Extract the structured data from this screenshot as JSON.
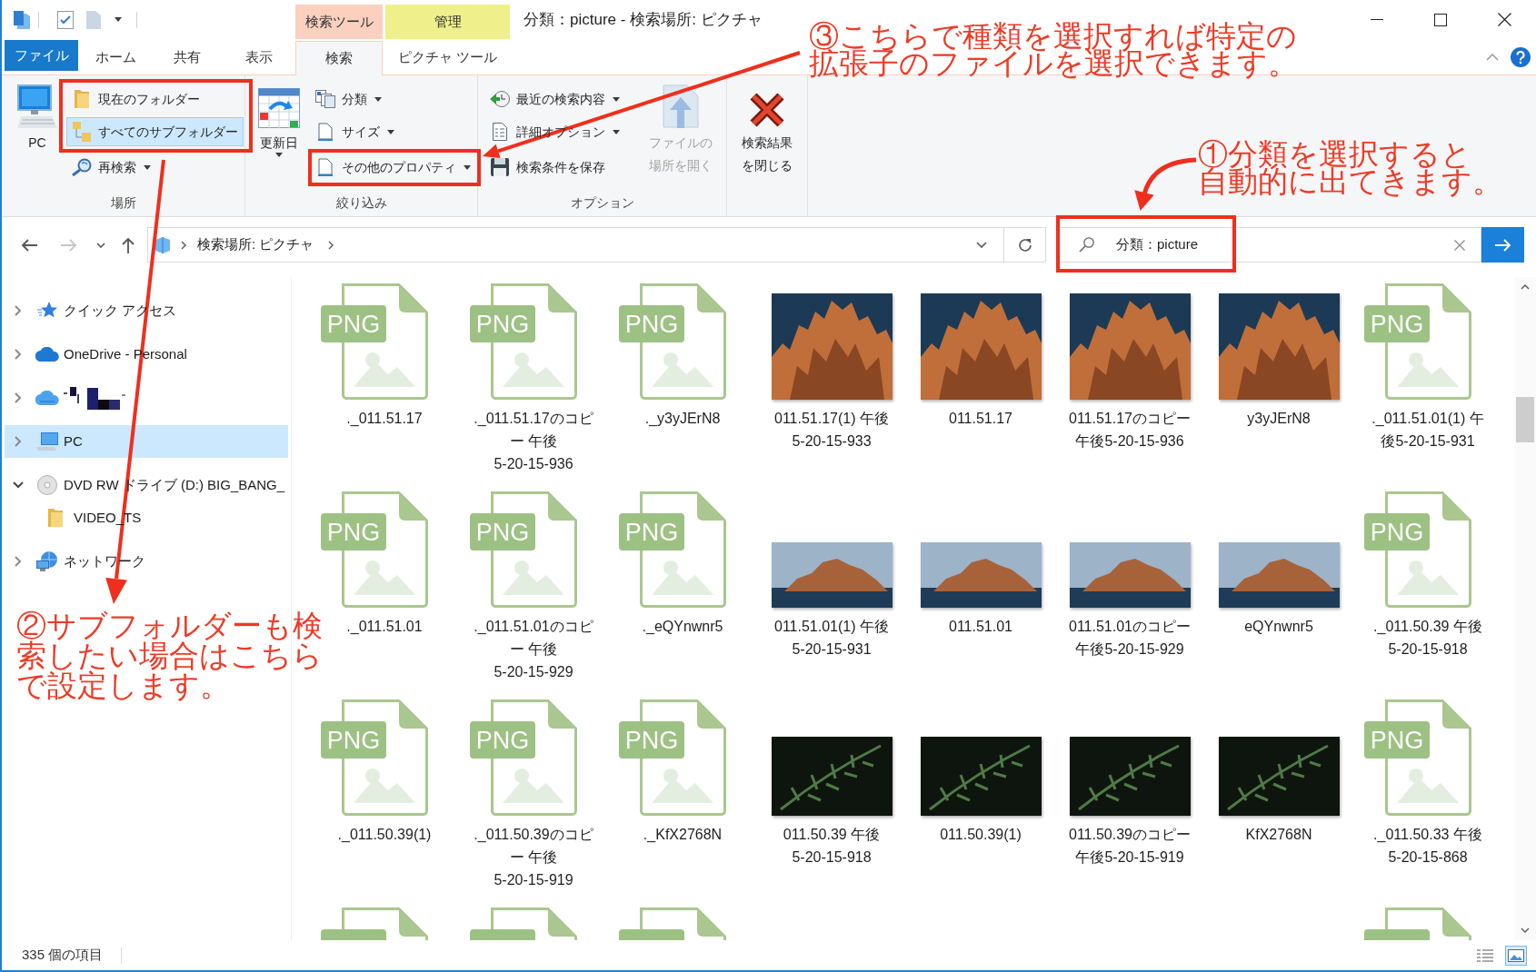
{
  "title_bar": {
    "title": "分類：picture - 検索場所: ピクチャ"
  },
  "tabs": [
    {
      "kind": "file",
      "label": "ファイル",
      "selected": false
    },
    {
      "kind": "normal",
      "label": "ホーム",
      "selected": false
    },
    {
      "kind": "normal",
      "label": "共有",
      "selected": false
    },
    {
      "kind": "normal",
      "label": "表示",
      "selected": false
    }
  ],
  "contextual_tabs": [
    {
      "header": "検索ツール",
      "color": "#fbd0bf",
      "tab": {
        "label": "検索",
        "selected": true
      }
    },
    {
      "header": "管理",
      "color": "#eff08c",
      "tab": {
        "label": "ピクチャ ツール",
        "selected": false
      }
    }
  ],
  "ribbon": {
    "groups": [
      {
        "label": "場所",
        "items": [
          {
            "kind": "large",
            "label": "PC",
            "dropdown": false,
            "disabled": false,
            "selected": false
          },
          {
            "kind": "small",
            "label": "現在のフォルダー",
            "dropdown": false,
            "disabled": false,
            "selected": false
          },
          {
            "kind": "small",
            "label": "すべてのサブフォルダー",
            "dropdown": false,
            "disabled": false,
            "selected": true
          },
          {
            "kind": "small",
            "label": "再検索",
            "dropdown": true,
            "disabled": false,
            "selected": false
          }
        ]
      },
      {
        "label": "絞り込み",
        "items": [
          {
            "kind": "large",
            "label": "更新日",
            "dropdown": true,
            "disabled": false
          },
          {
            "kind": "small",
            "label": "分類",
            "dropdown": true,
            "disabled": false
          },
          {
            "kind": "small",
            "label": "サイズ",
            "dropdown": true,
            "disabled": false
          },
          {
            "kind": "small",
            "label": "その他のプロパティ",
            "dropdown": true,
            "disabled": false
          }
        ]
      },
      {
        "label": "オプション",
        "items": [
          {
            "kind": "small",
            "label": "最近の検索内容",
            "dropdown": true,
            "disabled": false
          },
          {
            "kind": "small",
            "label": "詳細オプション",
            "dropdown": true,
            "disabled": false
          },
          {
            "kind": "small",
            "label": "検索条件を保存",
            "dropdown": false,
            "disabled": false
          },
          {
            "kind": "large",
            "label": "ファイルの場所を開く",
            "dropdown": false,
            "disabled": true
          }
        ]
      },
      {
        "items": [
          {
            "kind": "large",
            "label": "検索結果を閉じる",
            "dropdown": false,
            "disabled": false
          }
        ]
      }
    ]
  },
  "address_bar": {
    "nav_buttons": [
      {
        "kind": "back",
        "disabled": false
      },
      {
        "kind": "forward",
        "disabled": true
      },
      {
        "kind": "recent",
        "disabled": false
      },
      {
        "kind": "up",
        "disabled": false
      }
    ],
    "breadcrumbs": [
      "検索場所: ピクチャ"
    ]
  },
  "search_box": {
    "value": "分類：picture"
  },
  "navigation_pane": {
    "items": [
      {
        "kind": "quick_access",
        "label": "クイック アクセス",
        "expanded": false,
        "selected": false
      },
      {
        "kind": "onedrive",
        "label": "OneDrive - Personal",
        "expanded": false,
        "selected": false
      },
      {
        "kind": "cloud",
        "redacted": true,
        "expanded": false,
        "selected": false
      },
      {
        "kind": "pc",
        "label": "PC",
        "expanded": false,
        "selected": true
      },
      {
        "kind": "dvd",
        "label": "DVD RW ドライブ (D:) BIG_BANG_",
        "expanded": true,
        "selected": false,
        "children": [
          {
            "kind": "folder",
            "label": "VIDEO_TS",
            "selected": false
          }
        ]
      },
      {
        "kind": "network",
        "label": "ネットワーク",
        "expanded": false,
        "selected": false
      }
    ]
  },
  "files": {
    "rows": [
      {
        "cut_off": false,
        "items": [
          {
            "kind": "png",
            "badge": "PNG",
            "name": "._011.51.17"
          },
          {
            "kind": "png",
            "badge": "PNG",
            "name": "._011.51.17のコピー 午後5-20-15-936"
          },
          {
            "kind": "png",
            "badge": "PNG",
            "name": "._y3yJErN8"
          },
          {
            "kind": "photo",
            "name": "011.51.17(1) 午後5-20-15-933"
          },
          {
            "kind": "photo",
            "name": "011.51.17"
          },
          {
            "kind": "photo",
            "name": "011.51.17のコピー午後5-20-15-936"
          },
          {
            "kind": "photo",
            "name": "y3yJErN8"
          },
          {
            "kind": "png",
            "badge": "PNG",
            "name": "._011.51.01(1) 午後5-20-15-931"
          }
        ]
      },
      {
        "cut_off": false,
        "items": [
          {
            "kind": "png",
            "badge": "PNG",
            "name": "._011.51.01"
          },
          {
            "kind": "png",
            "badge": "PNG",
            "name": "._011.51.01のコピー 午後5-20-15-929"
          },
          {
            "kind": "png",
            "badge": "PNG",
            "name": "._eQYnwnr5"
          },
          {
            "kind": "photo",
            "name": "011.51.01(1) 午後5-20-15-931"
          },
          {
            "kind": "photo",
            "name": "011.51.01"
          },
          {
            "kind": "photo",
            "name": "011.51.01のコピー午後5-20-15-929"
          },
          {
            "kind": "photo",
            "name": "eQYnwnr5"
          },
          {
            "kind": "png",
            "badge": "PNG",
            "name": "._011.50.39 午後5-20-15-918"
          }
        ]
      },
      {
        "cut_off": false,
        "items": [
          {
            "kind": "png",
            "badge": "PNG",
            "name": "._011.50.39(1)"
          },
          {
            "kind": "png",
            "badge": "PNG",
            "name": "._011.50.39のコピー 午後5-20-15-919"
          },
          {
            "kind": "png",
            "badge": "PNG",
            "name": "._KfX2768N"
          },
          {
            "kind": "photo",
            "name": "011.50.39 午後5-20-15-918"
          },
          {
            "kind": "photo",
            "name": "011.50.39(1)"
          },
          {
            "kind": "photo",
            "name": "011.50.39のコピー午後5-20-15-919"
          },
          {
            "kind": "photo",
            "name": "KfX2768N"
          },
          {
            "kind": "png",
            "badge": "PNG",
            "name": "._011.50.33 午後5-20-15-868"
          }
        ]
      },
      {
        "cut_off": true,
        "items": [
          {
            "kind": "png"
          },
          {
            "kind": "png"
          },
          {
            "kind": "png"
          },
          {
            "kind": "blank"
          },
          {
            "kind": "blank"
          },
          {
            "kind": "blank"
          },
          {
            "kind": "blank"
          },
          {
            "kind": "png"
          }
        ]
      }
    ]
  },
  "status_bar": {
    "item_count": "335 個の項目",
    "view_buttons": [
      {
        "kind": "details",
        "selected": false
      },
      {
        "kind": "large_icons",
        "selected": true
      }
    ]
  },
  "annotations": [
    {
      "text": "③こちらで種類を選択すれば特定の拡張子のファイルを選択できます。"
    },
    {
      "text": "①分類を選択すると"
    },
    {
      "text": "自動的に出てきます。"
    },
    {
      "text": "②サブフォルダーも検索したい場合はこちらで設定します。"
    }
  ]
}
